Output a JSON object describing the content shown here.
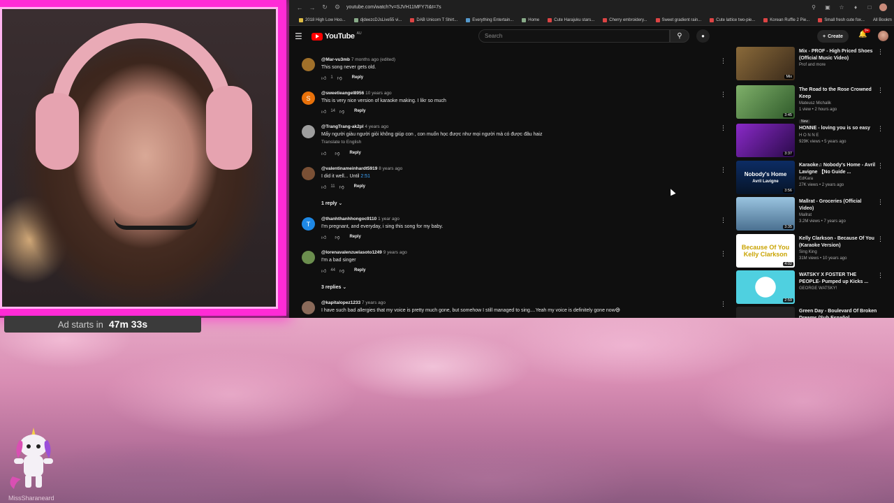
{
  "stream": {
    "ad_label": "Ad starts in",
    "ad_time": "47m 33s",
    "streamer_name": "MissSharaneard"
  },
  "browser": {
    "url": "youtube.com/watch?v=SJVH11MFY7I&t=7s",
    "bookmarks": [
      "2018 High Low Hoo...",
      "djdeezcDJsLive55 vi...",
      "DAB Unicorn T Shirt...",
      "Everything Entertain...",
      "Home",
      "Cute Harajuku stars...",
      "Cherry embroidery...",
      "Sweet gradient rain...",
      "Cute lattice two-pie...",
      "Korean Ruffle 2 Pie...",
      "Small fresh cute fox..."
    ],
    "all_bookmarks": "All Bookm"
  },
  "youtube": {
    "logo_text": "YouTube",
    "logo_region": "AU",
    "search_placeholder": "Search",
    "create_label": "Create",
    "notif_count": "9+"
  },
  "comments": [
    {
      "author": "@Mar-vu3mb",
      "time": "7 months ago (edited)",
      "text": "This song never gets old.",
      "likes": "1",
      "reply": "Reply",
      "avatar_color": "#a0702a",
      "avatar_letter": ""
    },
    {
      "author": "@sweetieangel8956",
      "time": "10 years ago",
      "text": "This is very nice version of karaoke making. I likr so much",
      "likes": "14",
      "reply": "Reply",
      "avatar_color": "#e8710a",
      "avatar_letter": "S"
    },
    {
      "author": "@TrangTrang-ak2pl",
      "time": "4 years ago",
      "text": "Mấy người giàu người giỏi không giúp con , con muốn học được như mọi người mà có được đâu haiz",
      "translate": "Translate to English",
      "likes": "",
      "reply": "Reply",
      "avatar_color": "#9e9e9e",
      "avatar_letter": ""
    },
    {
      "author": "@valentinameinhardt5919",
      "time": "8 years ago",
      "text": "I did it well... Until ",
      "link": "2:51",
      "likes": "11",
      "reply": "Reply",
      "avatar_color": "#7a5035",
      "avatar_letter": ""
    },
    {
      "author": "@thanhthanhhongoc9110",
      "time": "1 year ago",
      "text": "I'm pregnant, and everyday, i sing this song for my baby.",
      "likes": "",
      "reply": "Reply",
      "avatar_color": "#1e88e5",
      "avatar_letter": "T"
    },
    {
      "author": "@lorenavalenzuelasoto1249",
      "time": "9 years ago",
      "text": "I'm a bad singer",
      "likes": "44",
      "reply": "Reply",
      "avatar_color": "#6b8e4e",
      "avatar_letter": ""
    },
    {
      "author": "@kapitalopez1233",
      "time": "7 years ago",
      "text": "I have such bad allergies that my voice is pretty much gone, but somehow I still managed to sing....Yeah my voice is definitely gone now😅",
      "likes": "",
      "reply": "",
      "avatar_color": "#8a6a5a",
      "avatar_letter": ""
    }
  ],
  "reply_toggles": [
    "1 reply",
    "3 replies"
  ],
  "sidebar": [
    {
      "title": "Mix - PROF - High Priced Shoes (Official Music Video)",
      "channel": "Prof and more",
      "stats": "",
      "duration": "Mix",
      "thumb_color": "#6b4a2a"
    },
    {
      "title": "The Road to the Rose Crowned Keep",
      "channel": "Mateusz Michalik",
      "stats": "1 view • 2 hours ago",
      "new": "New",
      "duration": "3:45",
      "thumb_color": "#3f7a3a"
    },
    {
      "title": "HONNE - loving you is so easy",
      "channel": "H O N N E",
      "stats": "929K views • 5 years ago",
      "duration": "3:37",
      "thumb_color": "#5a1a8a"
    },
    {
      "title": "Karaoke♫ Nobody's Home - Avril Lavigne 【No Guide ...",
      "channel": "EdKara",
      "stats": "27K views • 2 years ago",
      "duration": "3:56",
      "thumb_color": "#0a2a5a",
      "thumb_text": "Nobody's Home",
      "thumb_sub": "Avril Lavigne"
    },
    {
      "title": "Mallrat - Groceries (Official Video)",
      "channel": "Mallrat",
      "stats": "3.2M views • 7 years ago",
      "duration": "3:35",
      "thumb_color": "#7aa8c8"
    },
    {
      "title": "Kelly Clarkson - Because Of You (Karaoke Version)",
      "channel": "Sing King",
      "stats": "31M views • 10 years ago",
      "duration": "4:02",
      "thumb_color": "#ffffff",
      "thumb_text": "Because Of You",
      "thumb_sub": "Kelly Clarkson"
    },
    {
      "title": "WATSKY X FOSTER THE PEOPLE- Pumped up Kicks ...",
      "channel": "GEORGE WATSKY!",
      "stats": "",
      "duration": "2:59",
      "thumb_color": "#4fd0e0"
    },
    {
      "title": "Green Day - Boulevard Of Broken Dreams (Sub Español ...",
      "channel": "",
      "stats": "",
      "duration": "",
      "thumb_color": "#222222"
    }
  ],
  "colors": {
    "cam_border": "#ff2bd6",
    "yt_bg": "#0f0f0f",
    "yt_red": "#ff0000",
    "link_blue": "#3ea6ff"
  }
}
